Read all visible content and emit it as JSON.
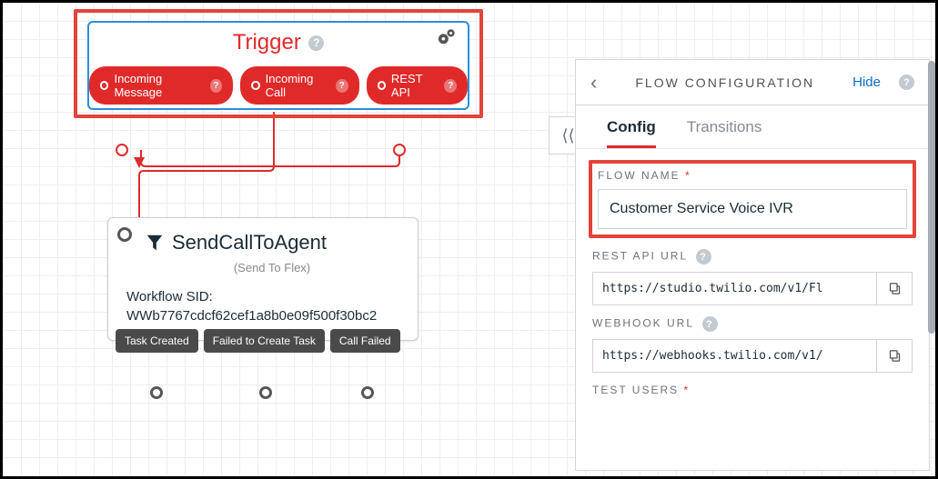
{
  "trigger": {
    "title": "Trigger",
    "pills": [
      {
        "label": "Incoming Message"
      },
      {
        "label": "Incoming Call"
      },
      {
        "label": "REST API"
      }
    ]
  },
  "sendWidget": {
    "title": "SendCallToAgent",
    "subtitle": "(Send To Flex)",
    "body_label": "Workflow SID:",
    "body_value": "WWb7767cdcf62cef1a8b0e09f500f30bc2",
    "outs": [
      {
        "label": "Task Created"
      },
      {
        "label": "Failed to Create Task"
      },
      {
        "label": "Call Failed"
      }
    ]
  },
  "panel": {
    "title": "FLOW CONFIGURATION",
    "hide": "Hide",
    "tabs": {
      "config": "Config",
      "transitions": "Transitions"
    },
    "flow_name_label": "FLOW NAME",
    "flow_name_value": "Customer Service Voice IVR",
    "rest_api_label": "REST API URL",
    "rest_api_value": "https://studio.twilio.com/v1/Fl",
    "webhook_label": "WEBHOOK URL",
    "webhook_value": "https://webhooks.twilio.com/v1/",
    "test_users_label": "TEST USERS"
  }
}
